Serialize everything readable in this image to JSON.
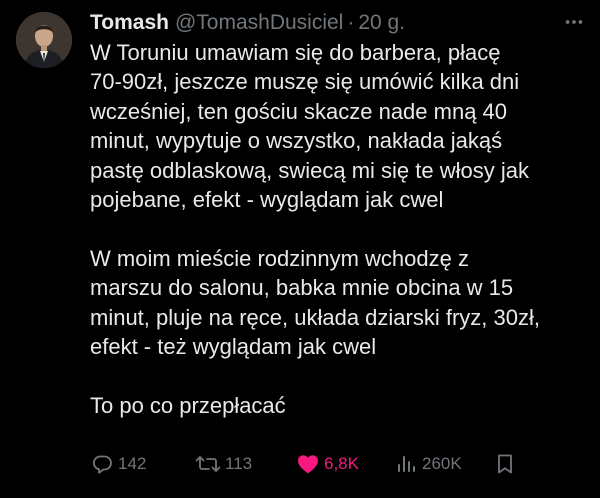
{
  "author": {
    "display_name": "Tomash",
    "handle": "@TomashDusiciel",
    "separator": "·",
    "time": "20 g."
  },
  "tweet": {
    "paragraphs": [
      {
        "lines": [
          "W Toruniu umawiam się do barbera, płacę",
          "70-90zł, jeszcze muszę się umówić kilka dni",
          "wcześniej, ten gościu skacze nade mną 40",
          "minut, wypytuje o wszystko, nakłada jakąś",
          "pastę odblaskową, swiecą mi się te włosy jak",
          "pojebane, efekt - wyglądam jak cwel"
        ]
      },
      {
        "lines": [
          "W moim mieście rodzinnym wchodzę z",
          "marszu do salonu, babka mnie obcina w 15",
          "minut, pluje na ręce, układa dziarski fryz, 30zł,",
          "efekt - też wyglądam jak cwel"
        ]
      },
      {
        "lines": [
          "To po co przepłacać"
        ]
      }
    ]
  },
  "actions": {
    "replies": "142",
    "retweets": "113",
    "likes": "6,8K",
    "views": "260K"
  },
  "icons": {
    "more": "more-horizontal-icon",
    "reply": "reply-icon",
    "retweet": "retweet-icon",
    "like": "heart-filled-icon",
    "views": "views-bar-chart-icon",
    "bookmark": "bookmark-icon"
  },
  "colors": {
    "background": "#000000",
    "text": "#e7e9ea",
    "muted": "#71767b",
    "like": "#f91880"
  }
}
